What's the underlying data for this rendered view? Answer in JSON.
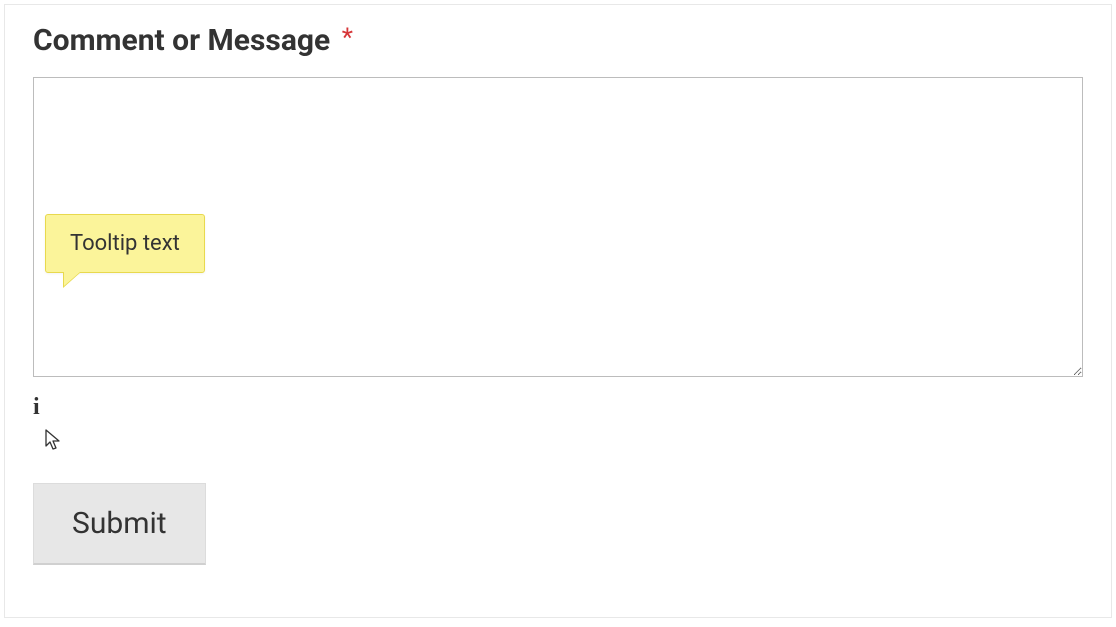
{
  "form": {
    "field_label": "Comment or Message",
    "required_marker": "*",
    "textarea_value": "",
    "textarea_placeholder": "",
    "tooltip_text": "Tooltip text",
    "info_glyph": "i",
    "submit_label": "Submit"
  }
}
